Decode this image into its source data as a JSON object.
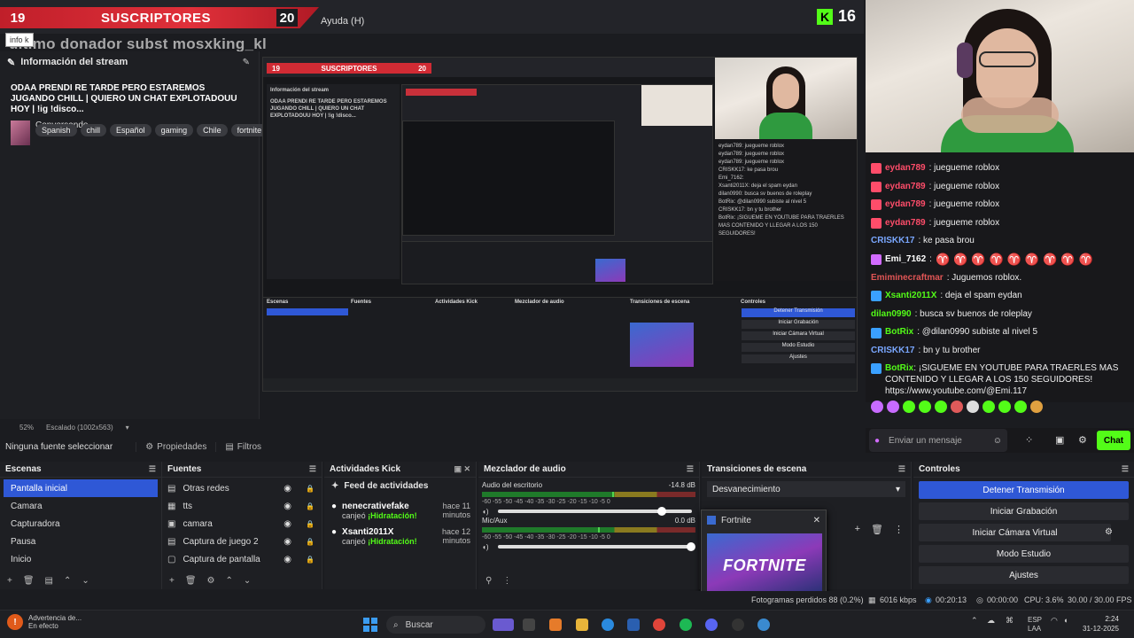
{
  "overlay": {
    "sub_count": "19",
    "sub_label": "SUSCRIPTORES",
    "sub_goal": "20",
    "menu_help": "Ayuda (H)",
    "kick_logo": "K",
    "kick_count": "16",
    "last_donation": "último donador subst mosxking_kl",
    "info_chip": "info k"
  },
  "stream_info": {
    "header": "Información del stream",
    "title": "ODAA PRENDI RE TARDE PERO ESTAREMOS JUGANDO CHILL | QUIERO UN CHAT EXPLOTADOUU HOY | !ig !disco...",
    "category": "Conversando",
    "tags": [
      "Spanish",
      "chill",
      "Español",
      "gaming",
      "Chile",
      "fortnite"
    ]
  },
  "preview": {
    "banner_left": "19",
    "banner_label": "SUSCRIPTORES",
    "banner_right": "20",
    "inner_title": "ODAA PRENDI RE TARDE PERO ESTAREMOS JUGANDO CHILL | QUIERO UN CHAT EXPLOTADOUU HOY | !ig !disco...",
    "inner_header": "Información del stream",
    "inner_dock_labels": [
      "Escenas",
      "Fuentes",
      "Actividades Kick",
      "Mezclador de audio",
      "Transiciones de escena",
      "Controles"
    ],
    "inner_ctrl": [
      "Detener Transmisión",
      "Iniciar Grabación",
      "Iniciar Cámara Virtual",
      "Modo Estudio",
      "Ajustes"
    ],
    "inner_chat": [
      "eydan789: juegueme roblox",
      "eydan789: juegueme roblox",
      "eydan789: juegueme roblox",
      "CRISKK17: ke pasa brou",
      "Emi_7162:",
      "Xsanti2011X: deja el spam eydan",
      "dilan0990: busca sv buenos de roleplay",
      "BotRix: @dilan0990 subiste al nivel 5",
      "CRISKK17: bn y tu brother",
      "BotRix: ¡SIGUEME EN YOUTUBE PARA TRAERLES MAS CONTENIDO Y LLEGAR A LOS 150 SEGUIDORES!"
    ]
  },
  "chat": {
    "messages": [
      {
        "user": "eydan789",
        "text": ": juegueme roblox",
        "color": "#ff4d6a",
        "badge": "#ff4d6a"
      },
      {
        "user": "eydan789",
        "text": ": juegueme roblox",
        "color": "#ff4d6a",
        "badge": "#ff4d6a"
      },
      {
        "user": "eydan789",
        "text": ": juegueme roblox",
        "color": "#ff4d6a",
        "badge": "#ff4d6a"
      },
      {
        "user": "eydan789",
        "text": ": juegueme roblox",
        "color": "#ff4d6a",
        "badge": "#ff4d6a"
      },
      {
        "user": "CRISKK17",
        "text": ": ke pasa brou",
        "color": "#7aa7ff",
        "badge": ""
      },
      {
        "user": "Emi_7162",
        "text": ":",
        "color": "#ffffff",
        "badge": "#d16bff",
        "emotes": 9
      },
      {
        "user": "Emiminecraftmar",
        "text": ": Juguemos roblox.",
        "color": "#e05555",
        "badge": ""
      },
      {
        "user": "Xsanti2011X",
        "text": ": deja el spam eydan",
        "color": "#53fc18",
        "badge": "#3aa0ff"
      },
      {
        "user": "dilan0990",
        "text": ": busca sv buenos de roleplay",
        "color": "#53fc18",
        "badge": ""
      },
      {
        "user": "BotRix",
        "text": ": @dilan0990 subiste al nivel 5",
        "color": "#53fc18",
        "badge": "#3aa0ff"
      },
      {
        "user": "CRISKK17",
        "text": ": bn y tu brother",
        "color": "#7aa7ff",
        "badge": ""
      },
      {
        "user": "BotRix",
        "text": ": ¡SIGUEME EN YOUTUBE PARA TRAERLES MAS CONTENIDO Y LLEGAR A LOS 150 SEGUIDORES! https://www.youtube.com/@Emi.117",
        "color": "#53fc18",
        "badge": "#3aa0ff",
        "wrap": true
      }
    ],
    "input_placeholder": "Enviar un mensaje",
    "send_label": "Chat"
  },
  "status_line": {
    "zoom": "52%",
    "scale": "Escalado (1002x563)"
  },
  "source_bar": {
    "none_selected": "Ninguna fuente seleccionar",
    "properties": "Propiedades",
    "filters": "Filtros"
  },
  "docks": {
    "scenes": {
      "title": "Escenas",
      "items": [
        "Pantalla inicial",
        "Camara",
        "Capturadora",
        "Pausa",
        "Inicio"
      ],
      "selected": 0
    },
    "sources": {
      "title": "Fuentes",
      "items": [
        "Otras redes",
        "tts",
        "camara",
        "Captura de juego 2",
        "Captura de pantalla"
      ]
    },
    "activity": {
      "title": "Actividades Kick",
      "feed_title": "Feed de actividades",
      "items": [
        {
          "user": "nenecrativefake",
          "action": "canjeó",
          "reward": "¡Hidratación!",
          "time": "hace 11 minutos"
        },
        {
          "user": "Xsanti2011X",
          "action": "canjeó",
          "reward": "¡Hidratación!",
          "time": "hace 12 minutos"
        }
      ]
    },
    "mixer": {
      "title": "Mezclador de audio",
      "channels": [
        {
          "name": "Audio del escritorio",
          "db": "-14.8 dB",
          "level": 0.62,
          "volume": 0.85
        },
        {
          "name": "Mic/Aux",
          "db": "0.0 dB",
          "level": 0.55,
          "volume": 1.0
        }
      ],
      "ticks": "-60 -55 -50 -45 -40 -35 -30 -25 -20 -15 -10 -5 0"
    },
    "transitions": {
      "title": "Transiciones de escena",
      "selected": "Desvanecimiento"
    },
    "controls": {
      "title": "Controles",
      "buttons": [
        "Detener Transmisión",
        "Iniciar Grabación",
        "Iniciar Cámara Virtual",
        "Modo Estudio",
        "Ajustes"
      ]
    }
  },
  "popup": {
    "title": "Fortnite",
    "thumb_text": "FORTNITE"
  },
  "status": {
    "frames": "Fotogramas perdidos 88 (0.2%)",
    "bitrate": "6016 kbps",
    "time": "00:20:13",
    "rec_time": "00:00:00",
    "cpu": "CPU: 3.6%",
    "fps": "30.00 / 30.00 FPS"
  },
  "taskbar": {
    "warning_title": "Advertencia de...",
    "warning_sub": "En efecto",
    "search": "Buscar",
    "lang": "ESP",
    "lang2": "LAA",
    "time": "2:24",
    "date": "31-12-2025"
  }
}
